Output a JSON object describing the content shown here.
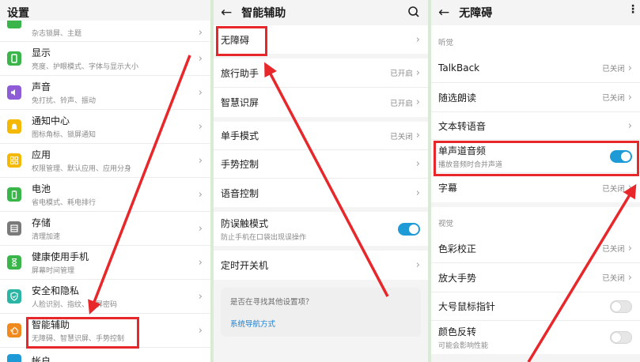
{
  "panel1": {
    "title": "设置",
    "items": [
      {
        "label": "",
        "sub": "杂志锁屏、主题",
        "color": "#39b54a"
      },
      {
        "label": "显示",
        "sub": "亮度、护眼模式、字体与显示大小",
        "color": "#39b54a"
      },
      {
        "label": "声音",
        "sub": "免打扰、铃声、振动",
        "color": "#8d5cd6"
      },
      {
        "label": "通知中心",
        "sub": "图标角标、锁屏通知",
        "color": "#f5b800"
      },
      {
        "label": "应用",
        "sub": "权限管理、默认应用、应用分身",
        "color": "#f5b800"
      },
      {
        "label": "电池",
        "sub": "省电模式、耗电排行",
        "color": "#39b54a"
      },
      {
        "label": "存储",
        "sub": "清理加速",
        "color": "#7a7a7a"
      },
      {
        "label": "健康使用手机",
        "sub": "屏幕时间管理",
        "color": "#39b54a"
      },
      {
        "label": "安全和隐私",
        "sub": "人脸识别、指纹、锁屏密码",
        "color": "#2bb5a5"
      },
      {
        "label": "智能辅助",
        "sub": "无障碍、智慧识屏、手势控制",
        "color": "#f08a1c"
      },
      {
        "label": "帐户",
        "sub": "",
        "color": "#1e9bd7"
      }
    ]
  },
  "panel2": {
    "title": "智能辅助",
    "items": [
      {
        "label": "无障碍",
        "status": ""
      },
      {
        "label": "旅行助手",
        "status": "已开启"
      },
      {
        "label": "智慧识屏",
        "status": "已开启"
      },
      {
        "label": "单手模式",
        "status": "已关闭"
      },
      {
        "label": "手势控制",
        "status": ""
      },
      {
        "label": "语音控制",
        "status": ""
      },
      {
        "label": "防误触模式",
        "sub": "防止手机在口袋出现误操作"
      },
      {
        "label": "定时开关机",
        "status": ""
      }
    ],
    "find_card": {
      "question": "是否在寻找其他设置项？",
      "link": "系统导航方式"
    }
  },
  "panel3": {
    "title": "无障碍",
    "section_hearing": "听觉",
    "section_vision": "视觉",
    "hearing_items": [
      {
        "label": "TalkBack",
        "status": "已关闭"
      },
      {
        "label": "随选朗读",
        "status": "已关闭"
      },
      {
        "label": "文本转语音",
        "status": ""
      },
      {
        "label": "单声道音频",
        "sub": "播放音频时合并声道"
      },
      {
        "label": "字幕",
        "status": "已关闭"
      }
    ],
    "vision_items": [
      {
        "label": "色彩校正",
        "status": "已关闭"
      },
      {
        "label": "放大手势",
        "status": "已关闭"
      },
      {
        "label": "大号鼠标指针",
        "status": ""
      },
      {
        "label": "颜色反转",
        "sub": "可能会影响性能"
      }
    ]
  },
  "colors": {
    "accent": "#1e9bd7",
    "highlight": "#e8272b",
    "background": "#f4f4f4"
  }
}
